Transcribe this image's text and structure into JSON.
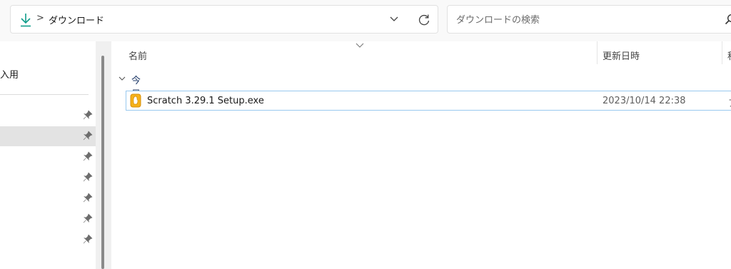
{
  "address_bar": {
    "breadcrumb_separator": ">",
    "breadcrumb_current": "ダウンロード",
    "icon_download": "download-arrow-icon",
    "icon_history": "chevron-down-icon",
    "icon_refresh": "refresh-icon"
  },
  "search": {
    "placeholder": "ダウンロードの検索",
    "icon": "search-icon"
  },
  "nav_pane": {
    "partial_label": "入用",
    "pinned_items_count": 7
  },
  "columns": {
    "name": "名前",
    "date_modified": "更新日時",
    "type_partial": "種"
  },
  "group": {
    "label": "今日"
  },
  "files": [
    {
      "name": "Scratch 3.29.1 Setup.exe",
      "date": "2023/10/14 22:38",
      "type_partial": "ア",
      "icon": "scratch-setup-icon"
    }
  ],
  "colors": {
    "accent": "#0f9d8a",
    "selection_border": "#99c9ef",
    "nav_selected": "#e3e3e3",
    "file_icon": "#f6b21a"
  }
}
